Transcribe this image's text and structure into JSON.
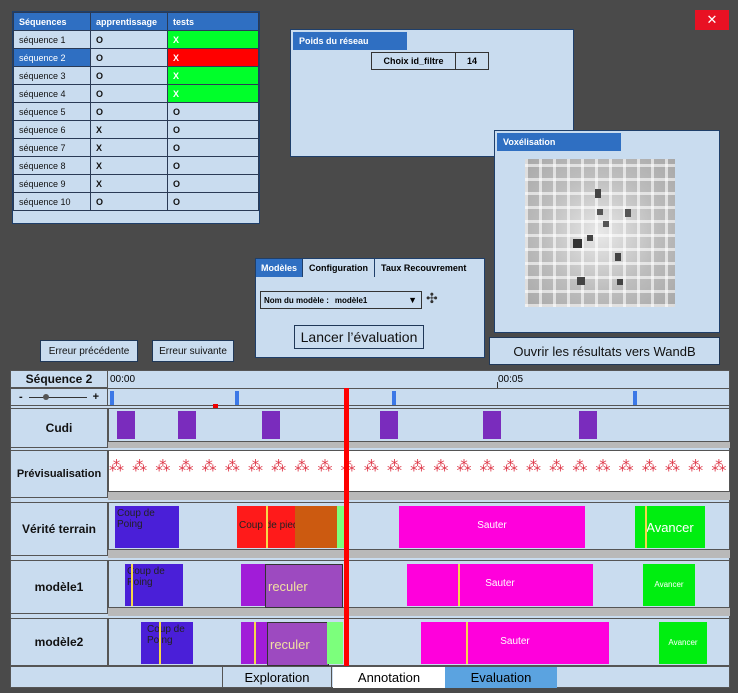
{
  "close_icon": "close-icon",
  "sequences": {
    "headers": [
      "Séquences",
      "apprentissage",
      "tests"
    ],
    "rows": [
      {
        "name": "séquence 1",
        "learn": "O",
        "test": "X",
        "test_color": "green"
      },
      {
        "name": "séquence 2",
        "learn": "O",
        "test": "X",
        "test_color": "red",
        "selected": true
      },
      {
        "name": "séquence 3",
        "learn": "O",
        "test": "X",
        "test_color": "green"
      },
      {
        "name": "séquence 4",
        "learn": "O",
        "test": "X",
        "test_color": "green"
      },
      {
        "name": "séquence 5",
        "learn": "O",
        "test": "O",
        "test_color": ""
      },
      {
        "name": "séquence 6",
        "learn": "X",
        "test": "O",
        "test_color": ""
      },
      {
        "name": "séquence 7",
        "learn": "X",
        "test": "O",
        "test_color": ""
      },
      {
        "name": "séquence 8",
        "learn": "X",
        "test": "O",
        "test_color": ""
      },
      {
        "name": "séquence 9",
        "learn": "X",
        "test": "O",
        "test_color": ""
      },
      {
        "name": "séquence 10",
        "learn": "O",
        "test": "O",
        "test_color": ""
      }
    ]
  },
  "weights": {
    "title": "Poids du réseau",
    "filter_label": "Choix id_filtre",
    "filter_value": "14"
  },
  "voxel": {
    "title": "Voxélisation"
  },
  "models": {
    "tabs": [
      "Modèles",
      "Configuration",
      "Taux Recouvrement"
    ],
    "model_label": "Nom du modèle :",
    "model_value": "modèle1",
    "launch": "Lancer l’évaluation"
  },
  "buttons": {
    "prev_error": "Erreur précédente",
    "next_error": "Erreur suivante",
    "open_results": "Ouvrir les résultats vers WandB"
  },
  "timeline": {
    "sequence_title": "Séquence 2",
    "zoom_minus": "-",
    "zoom_plus": "+",
    "time_start": "00:00",
    "time_mid": "00:05",
    "tracks": {
      "cudi": "Cudi",
      "preview": "Prévisualisation",
      "ground_truth": "Vérité terrain",
      "model1": "modèle1",
      "model2": "modèle2"
    },
    "gt_labels": {
      "punch": "Coup de Poing",
      "kick": "Coup de pied",
      "jump": "Sauter",
      "forward": "Avancer"
    },
    "m1_labels": {
      "punch": "Coup de Poing",
      "back": "reculer",
      "jump": "Sauter",
      "forward": "Avancer"
    },
    "m2_labels": {
      "punch": "Coup de Poing",
      "back": "reculer",
      "jump": "Sauter",
      "forward": "Avancer"
    }
  },
  "bottom_tabs": [
    "Exploration",
    "Annotation",
    "Evaluation"
  ],
  "colors": {
    "accent": "#2f6fc2",
    "panel": "#c9dcef",
    "punch": "#4a1fd8",
    "kick_red": "#ff1a1a",
    "kick_orange": "#cc5a10",
    "jump": "#ff00dc",
    "forward": "#00ee10",
    "back": "#a11cd8",
    "cursor": "#ff0000"
  }
}
